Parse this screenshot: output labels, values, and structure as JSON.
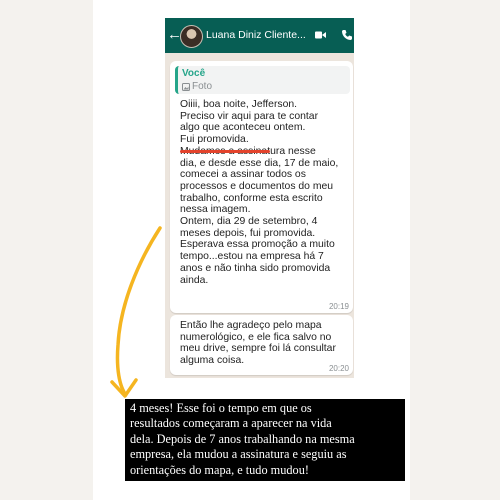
{
  "chat": {
    "contact_name": "Luana Diniz Cliente...",
    "back_icon": "back-arrow-icon",
    "video_icon": "video-call-icon",
    "call_icon": "phone-call-icon",
    "header_color": "#075e54",
    "quote": {
      "sender": "Você",
      "type": "Foto",
      "accent_color": "#25a58a"
    },
    "messages": [
      {
        "text": "Oiiii, boa noite, Jefferson.\nPreciso vir aqui para te contar\nalgo que aconteceu ontem.\nFui promovida.\nMudamos a assinatura nesse\ndia, e desde esse dia, 17 de maio,\ncomecei a assinar todos os\nprocessos e documentos do meu\ntrabalho, conforme esta escrito\nnessa imagem.\nOntem, dia 29 de setembro, 4\nmeses depois, fui promovida.\nEsperava essa promoção a muito\ntempo...estou na empresa há 7\nanos e não tinha sido promovida\nainda.",
        "time": "20:19"
      },
      {
        "text": "Então lhe agradeço pelo mapa\nnumerológico, e ele fica salvo no\nmeu drive, sempre foi lá consultar\nalguma coisa.",
        "time": "20:20"
      }
    ]
  },
  "caption": {
    "text": "4 meses! Esse foi o tempo em que os\nresultados começaram a aparecer na vida\ndela. Depois de 7 anos trabalhando na mesma\nempresa, ela mudou a assinatura e seguiu as\norientações do mapa, e tudo mudou!"
  },
  "colors": {
    "highlight_underline": "#e3432c",
    "arrow": "#f5b520"
  }
}
